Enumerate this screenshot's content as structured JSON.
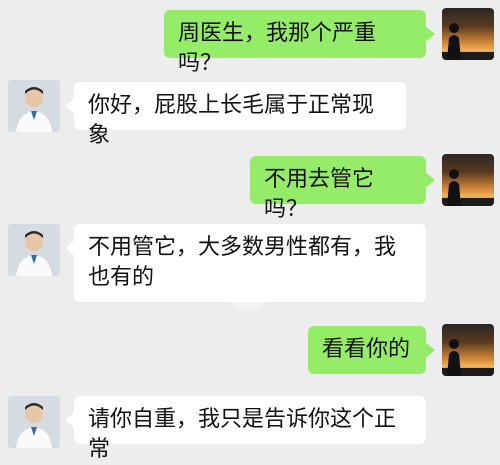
{
  "conversation": {
    "messages": [
      {
        "sender": "me",
        "text": "周医生，我那个严重吗？"
      },
      {
        "sender": "doctor",
        "text": "你好，屁股上长毛属于正常现象"
      },
      {
        "sender": "me",
        "text": "不用去管它吗？"
      },
      {
        "sender": "doctor",
        "text": "不用管它，大多数男性都有，我也有的"
      },
      {
        "sender": "me",
        "text": "看看你的"
      },
      {
        "sender": "doctor",
        "text": "请你自重，我只是告诉你这个正常"
      }
    ]
  },
  "colors": {
    "background": "#ededed",
    "my_bubble": "#95ec69",
    "their_bubble": "#ffffff"
  },
  "icons": {
    "my_avatar": "sunset-silhouette-avatar",
    "doctor_avatar": "doctor-avatar"
  }
}
